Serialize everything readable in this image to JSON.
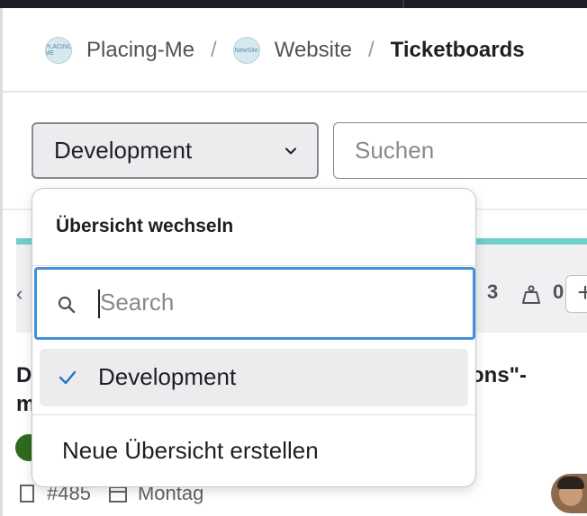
{
  "breadcrumb": {
    "items": [
      {
        "label": "Placing-Me",
        "avatar_text": "PLACING ME"
      },
      {
        "label": "Website",
        "avatar_text": "NewSite"
      },
      {
        "label": "Ticketboards"
      }
    ],
    "separator": "/"
  },
  "toolbar": {
    "board_select_value": "Development",
    "search_placeholder": "Suchen"
  },
  "board_list": {
    "header_color": "#6ecfcf",
    "issue_count_partial": "3",
    "weight": "0",
    "add_label": "+"
  },
  "card": {
    "title_line1_start": "D",
    "title_line2_start": "m",
    "title_line1_end": "ons\"-",
    "number": "#485",
    "due": "Montag",
    "label_color": "#2e6b1f"
  },
  "dropdown": {
    "title": "Übersicht wechseln",
    "search_placeholder": "Search",
    "items": [
      {
        "label": "Development",
        "selected": true
      }
    ],
    "create_label": "Neue Übersicht erstellen"
  },
  "colors": {
    "focus_blue": "#428fdc",
    "check_blue": "#1f75cb",
    "text": "#1f1e24"
  }
}
